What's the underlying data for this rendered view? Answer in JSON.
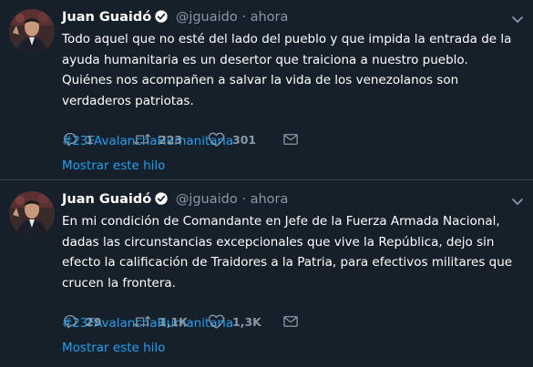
{
  "tweets": [
    {
      "author": {
        "name": "Juan Guaidó",
        "handle": "@jguaido",
        "separator": "·",
        "time": "ahora"
      },
      "text": "Todo aquel que no esté del lado del pueblo y que impida la entrada de la ayuda humanitaria es un desertor que traiciona a nuestro pueblo. Quiénes nos acompañen a salvar la vida de los venezolanos son verdaderos patriotas.",
      "hashtag": "#23FAvalanchaHumanitaria",
      "stats": {
        "replies": "1",
        "retweets": "223",
        "likes": "301"
      },
      "thread_link": "Mostrar este hilo"
    },
    {
      "author": {
        "name": "Juan Guaidó",
        "handle": "@jguaido",
        "separator": "·",
        "time": "ahora"
      },
      "text": "En mi condición de Comandante en Jefe de la Fuerza Armada Nacional, dadas las circunstancias excepcionales que vive la República, dejo sin efecto la calificación de Traidores a la Patria, para efectivos militares que crucen la frontera.",
      "hashtag": "#23FAvalanchaHumanitaria",
      "stats": {
        "replies": "29",
        "retweets": "1,1K",
        "likes": "1,3K"
      },
      "thread_link": "Mostrar este hilo"
    }
  ],
  "colors": {
    "background": "#15202b",
    "accent": "#1da1f2",
    "muted": "#8899a6",
    "divider": "#38444d"
  },
  "icons": [
    "verified-icon",
    "chevron-down-icon",
    "reply-icon",
    "retweet-icon",
    "like-icon",
    "dm-icon"
  ]
}
